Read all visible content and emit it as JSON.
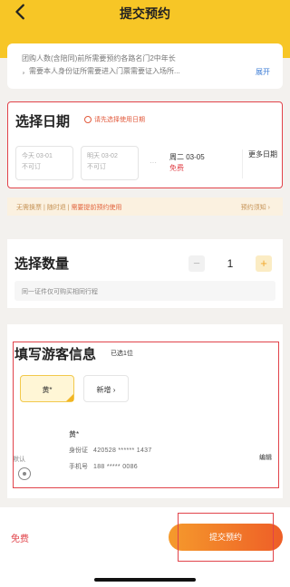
{
  "header": {
    "title": "提交预约"
  },
  "notice": {
    "line1": "团购人数(含陪同)前所需要预约各路名门2中年长",
    "line2": "，需要本人身份证所需要进入门票需要证入场所...",
    "more": "展开"
  },
  "date_section": {
    "title": "选择日期",
    "hint": "请先选择使用日期",
    "options": [
      {
        "day": "今天 03-01",
        "note": "不可订"
      },
      {
        "day": "明天 03-02",
        "note": "不可订"
      }
    ],
    "separator": "···",
    "selected": {
      "day": "周二 03-05",
      "price": "免费"
    },
    "more": "更多日期"
  },
  "info_strip": {
    "a": "无需换票",
    "b": "随时退",
    "warn": "需要提前预约使用",
    "link": "预约须知 ›"
  },
  "qty_section": {
    "title": "选择数量",
    "minus": "−",
    "value": "1",
    "plus": "+",
    "hint": "同一证件仅可购买相同行程"
  },
  "guest_section": {
    "title": "填写游客信息",
    "count": "已选1位",
    "selected_chip": "黄*",
    "add_chip": "新增 ›",
    "default_label": "默认",
    "guest": {
      "name": "黄*",
      "id_label": "身份证",
      "id_value": "420528 ****** 1437",
      "phone_label": "手机号",
      "phone_value": "188 ***** 0086"
    },
    "edit": "编辑"
  },
  "footer": {
    "price": "免费",
    "submit": "提交预约"
  },
  "colors": {
    "brand_yellow": "#f7c626",
    "accent_red": "#e1434a",
    "submit_start": "#f59a2c",
    "submit_end": "#ee5e27"
  }
}
